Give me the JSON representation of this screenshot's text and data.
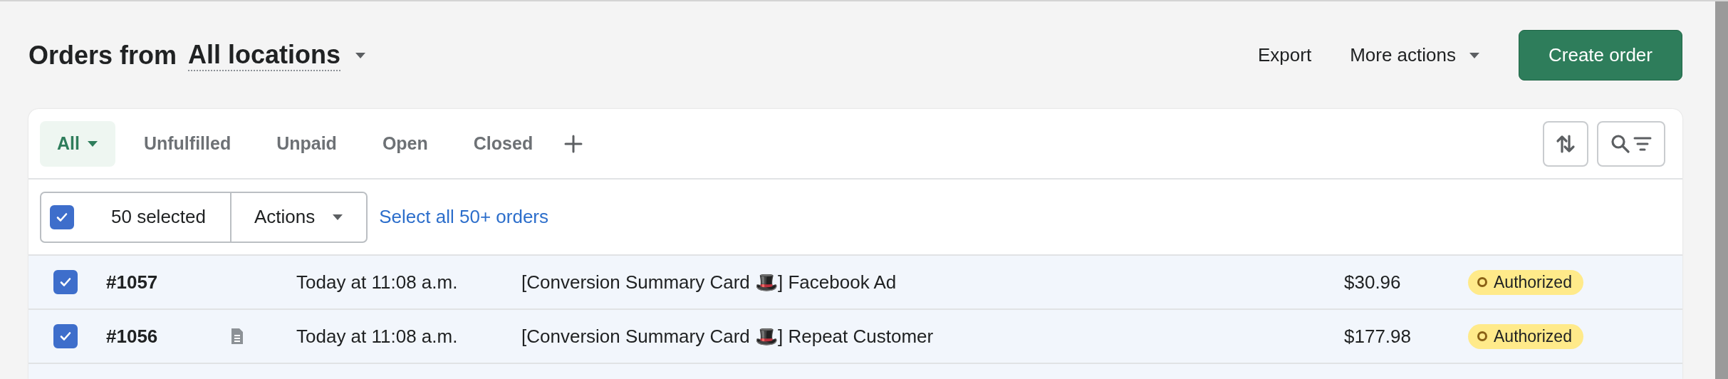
{
  "header": {
    "title": "Orders from",
    "location": "All locations",
    "actions": [
      {
        "label": "Export",
        "kind": "plain"
      },
      {
        "label": "More actions",
        "kind": "menu"
      }
    ],
    "primary": "Create order"
  },
  "tabs": [
    {
      "label": "All",
      "selected": true
    },
    {
      "label": "Unfulfilled",
      "selected": false
    },
    {
      "label": "Unpaid",
      "selected": false
    },
    {
      "label": "Open",
      "selected": false
    },
    {
      "label": "Closed",
      "selected": false
    }
  ],
  "bulk": {
    "checked": true,
    "count": "50 selected",
    "actions": "Actions",
    "select_all": "Select all 50+ orders"
  },
  "orders": [
    {
      "number": "#1057",
      "note": false,
      "selected": true,
      "date": "Today at 11:08 a.m.",
      "customer": "[Conversion Summary Card 🎩] Facebook Ad",
      "total": "$30.96",
      "payment": "Authorized"
    },
    {
      "number": "#1056",
      "note": true,
      "selected": true,
      "date": "Today at 11:08 a.m.",
      "customer": "[Conversion Summary Card 🎩] Repeat Customer",
      "total": "$177.98",
      "payment": "Authorized"
    }
  ]
}
